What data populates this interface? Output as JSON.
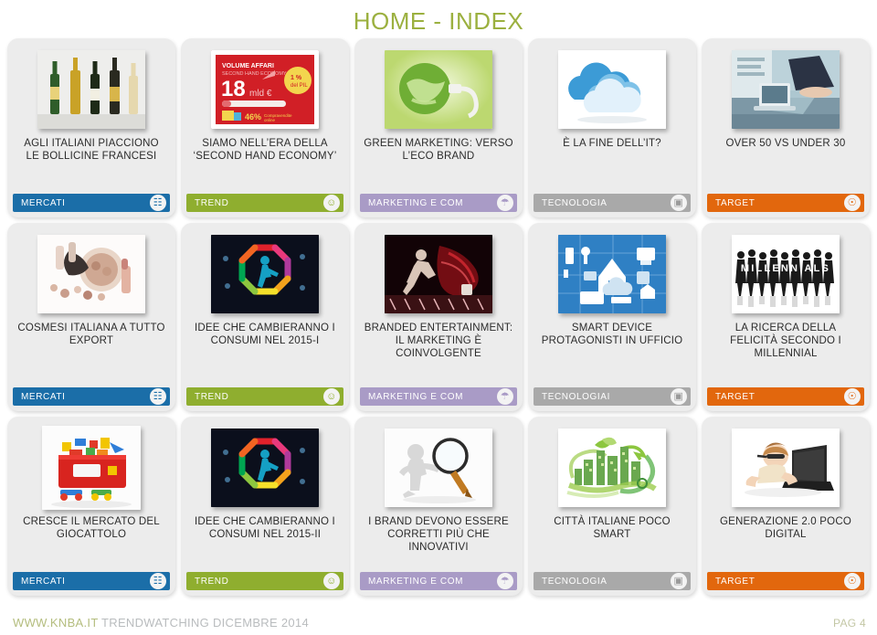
{
  "page": {
    "title": "HOME - INDEX"
  },
  "categories": {
    "mercati": {
      "label": "MERCATI",
      "color": "#1b6ea8",
      "icon": "bar-chart-icon"
    },
    "trend": {
      "label": "TREND",
      "color": "#8fae2f",
      "icon": "person-bulb-icon"
    },
    "marketing": {
      "label": "MARKETING E COM",
      "color": "#a99bc6",
      "icon": "person-globe-icon"
    },
    "tecnologia": {
      "label": "TECNOLOGIA",
      "color": "#a9a9a9",
      "icon": "device-icon"
    },
    "target": {
      "label": "TARGET",
      "color": "#e2670d",
      "icon": "person-target-icon"
    }
  },
  "rows": [
    {
      "cards": [
        {
          "title": "AGLI ITALIANI PIACCIONO LE BOLLICINE FRANCESI",
          "tag": "MERCATI",
          "tag_key": "mercati",
          "image": "champagne-bottles"
        },
        {
          "title": "SIAMO NELL’ERA DELLA ‘SECOND HAND ECONOMY’",
          "tag": "TREND",
          "tag_key": "trend",
          "image": "second-hand-economy-infographic"
        },
        {
          "title": "GREEN MARKETING: VERSO L’ECO BRAND",
          "tag": "MARKETING E COM",
          "tag_key": "marketing",
          "image": "green-globe-plug"
        },
        {
          "title": "È LA FINE DELL’IT?",
          "tag": "TECNOLOGIA",
          "tag_key": "tecnologia",
          "image": "blue-clouds"
        },
        {
          "title": "OVER 50 VS UNDER 30",
          "tag": "TARGET",
          "tag_key": "target",
          "image": "office-laptop-meeting"
        }
      ]
    },
    {
      "cards": [
        {
          "title": "COSMESI ITALIANA A TUTTO EXPORT",
          "tag": "MERCATI",
          "tag_key": "mercati",
          "image": "cosmetics-makeup"
        },
        {
          "title": "IDEE CHE CAMBIERANNO I CONSUMI NEL 2015-I",
          "tag": "TREND",
          "tag_key": "trend",
          "image": "rainbow-octagon-runner"
        },
        {
          "title": "BRANDED ENTERTAINMENT: IL MARKETING È COINVOLGENTE",
          "tag": "MARKETING E COM",
          "tag_key": "marketing",
          "image": "breakdancer-red"
        },
        {
          "title": "SMART DEVICE PROTAGONISTI IN UFFICIO",
          "tag": "TECNOLOGIAI",
          "tag_key": "tecnologia",
          "image": "smart-home-devices"
        },
        {
          "title": "LA RICERCA DELLA FELICITÀ SECONDO I MILLENNIAL",
          "tag": "TARGET",
          "tag_key": "target",
          "image": "millennials-silhouettes"
        }
      ]
    },
    {
      "cards": [
        {
          "title": "CRESCE IL MERCATO DEL GIOCATTOLO",
          "tag": "MERCATI",
          "tag_key": "mercati",
          "image": "red-toy-box"
        },
        {
          "title": "IDEE CHE CAMBIERANNO I CONSUMI NEL 2015-II",
          "tag": "TREND",
          "tag_key": "trend",
          "image": "rainbow-octagon-runner"
        },
        {
          "title": "I BRAND DEVONO ESSERE CORRETTI PIÙ CHE INNOVATIVI",
          "tag": "MARKETING E COM",
          "tag_key": "marketing",
          "image": "magnifier-figure"
        },
        {
          "title": "CITTÀ ITALIANE POCO SMART",
          "tag": "TECNOLOGIA",
          "tag_key": "tecnologia",
          "image": "green-eco-city"
        },
        {
          "title": "GENERAZIONE 2.0 POCO DIGITAL",
          "tag": "TARGET",
          "tag_key": "target",
          "image": "baby-with-laptop"
        }
      ]
    }
  ],
  "infographic": {
    "heading": "VOLUME AFFARI",
    "subheading": "SECOND HAND ECONOMY",
    "value": "18",
    "unit": "mld €",
    "badge_value": "1 %",
    "badge_label": "del PIL",
    "stat_value": "46%",
    "stat_label": "Compravendite online"
  },
  "millennials_word": "MILLENNIALS",
  "footer": {
    "site": "WWW.KNBA.IT",
    "meta": "TRENDWATCHING DICEMBRE 2014",
    "page_number": "PAG 4"
  }
}
